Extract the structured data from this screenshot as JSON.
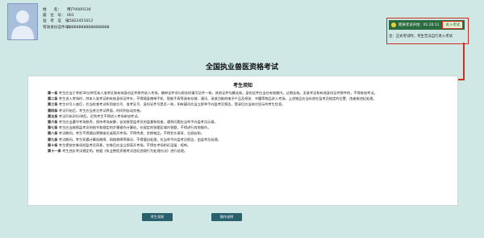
{
  "header": {
    "labels": [
      "姓　　名：",
      "座　位　号：",
      "准　考　证　号：",
      "有效身份证件号："
    ],
    "values": [
      "用户0000136",
      "001",
      "15822451612",
      "888888888888888888"
    ]
  },
  "exam_status": {
    "label": "距离考试开始：",
    "time": "01:20:11",
    "button_label": "进入考试",
    "note": "注：正式考试时，考生无法自行进入考试"
  },
  "page": {
    "title": "全国执业兽医资格考试"
  },
  "notice": {
    "title": "考生须知",
    "rules": [
      {
        "tag": "第一条",
        "text": "考生应当于考前30分钟凭本人准考证和有效身份证件原件进入考场，携带证件须与报名时填写证件一致，其他证件均属无效，身份证件应当在有效期内，过期无效。无准考证和有效身份证件原件的，不得参加考试。"
      },
      {
        "tag": "第二条",
        "text": "考生进入考场时，除本人准考证和有效身份证件外，不得随身携带手机、智能手表等具有存储、通讯、录放功能的电子产品及纸张、书籍等物品进入考场。上述物品应当存放在监考员指定的位置，违者按违纪处理。"
      },
      {
        "tag": "第三条",
        "text": "考生对号入座后，应当检查考试所用座位号、准考证号、身份证件号是否一致，如有疑问应当立即举手向监考员报告，登录后应当核对显示的考生信息。"
      },
      {
        "tag": "第四条",
        "text": "考试开始后，考生应当关注考试界面，时间到自动交卷。"
      },
      {
        "tag": "第五条",
        "text": "考试开始30分钟后，迟到考生不得进入考场参加考试。"
      },
      {
        "tag": "第六条",
        "text": "考生应当遵守考场秩序，保持考场安静，自觉接受监考员的监督和检查，遇到问题应当举手向监考员示意。"
      },
      {
        "tag": "第七条",
        "text": "考生应当按照监考员的指令和规定的步骤操作计算机，在规定的答题区域内答题，不得进行其他操作。"
      },
      {
        "tag": "第八条",
        "text": "考试期间，考生不得擅自更换座位或离开考场，不得传递、交换物品，不得交头接耳、左顾右盼。"
      },
      {
        "tag": "第九条",
        "text": "考试期间，考生如遇计算机故障、网络故障等情况，不得擅自处理，应当举手向监考员报告，由监考员处理。"
      },
      {
        "tag": "第十条",
        "text": "考生提前交卷须经监考员同意，交卷后应当立即离开考场，不得在考场附近逗留、喧哗。"
      },
      {
        "tag": "第十一条",
        "text": "考生违反考试规定的，依据《执业兽医资格考试违纪违规行为处理办法》进行处理。"
      }
    ]
  },
  "buttons": {
    "notice": "考生须知",
    "operation": "操作说明"
  }
}
